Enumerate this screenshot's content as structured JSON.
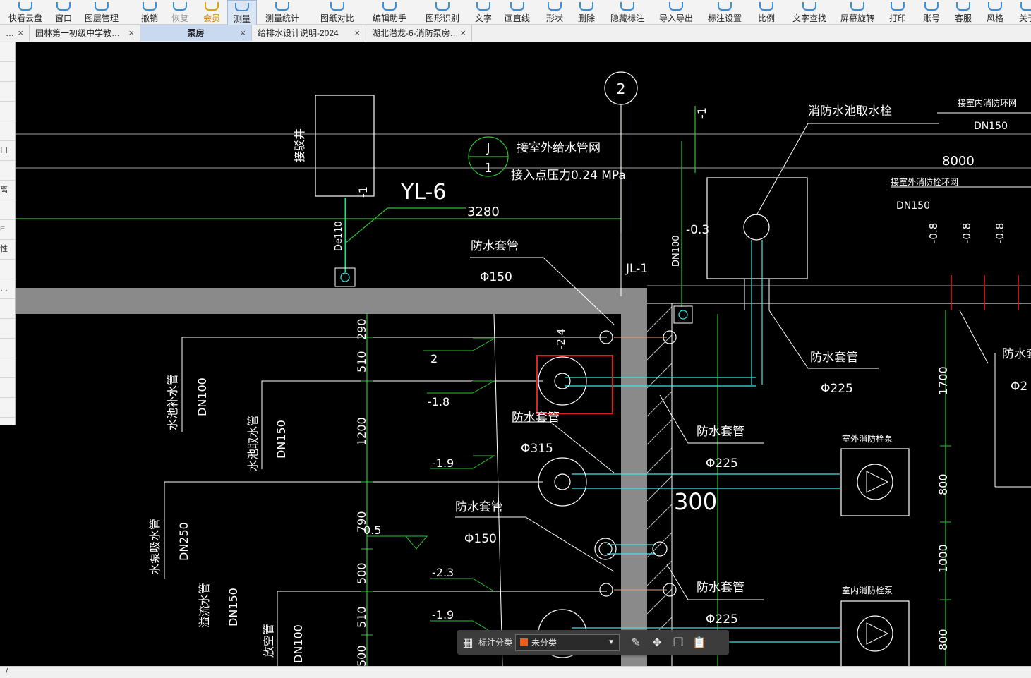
{
  "toolbar": {
    "items": [
      {
        "label": "快看云盘",
        "icon": "cloud-icon"
      },
      {
        "label": "窗口",
        "icon": "window-icon"
      },
      {
        "label": "图层管理",
        "icon": "layers-icon"
      },
      {
        "label": "撤销",
        "icon": "undo-icon"
      },
      {
        "label": "恢复",
        "icon": "redo-icon"
      },
      {
        "label": "会员",
        "icon": "crown-icon"
      },
      {
        "label": "测量",
        "icon": "ruler-icon"
      },
      {
        "label": "测量统计",
        "icon": "stats-icon"
      },
      {
        "label": "图纸对比",
        "icon": "compare-icon"
      },
      {
        "label": "编辑助手",
        "icon": "edit-icon"
      },
      {
        "label": "图形识别",
        "icon": "recognize-icon"
      },
      {
        "label": "文字",
        "icon": "text-icon"
      },
      {
        "label": "画直线",
        "icon": "line-icon"
      },
      {
        "label": "形状",
        "icon": "shape-icon"
      },
      {
        "label": "删除",
        "icon": "delete-icon"
      },
      {
        "label": "隐藏标注",
        "icon": "hide-icon"
      },
      {
        "label": "导入导出",
        "icon": "import-export-icon"
      },
      {
        "label": "标注设置",
        "icon": "settings-icon"
      },
      {
        "label": "比例",
        "icon": "scale-icon"
      },
      {
        "label": "文字查找",
        "icon": "search-icon"
      },
      {
        "label": "屏幕旋转",
        "icon": "rotate-icon"
      },
      {
        "label": "打印",
        "icon": "print-icon"
      },
      {
        "label": "账号",
        "icon": "account-icon"
      },
      {
        "label": "客服",
        "icon": "service-icon"
      },
      {
        "label": "风格",
        "icon": "style-icon"
      },
      {
        "label": "关于",
        "icon": "about-icon"
      }
    ]
  },
  "tabs": [
    {
      "label": "…"
    },
    {
      "label": "园林第一初级中学教…"
    },
    {
      "label": "泵房"
    },
    {
      "label": "给排水设计说明-2024"
    },
    {
      "label": "湖北潜龙-6-消防泵房…"
    }
  ],
  "close_glyph": "×",
  "left_panel": {
    "rows": [
      "",
      "",
      "",
      "",
      "",
      "口",
      "",
      "离",
      "",
      "E",
      "性",
      "",
      "…",
      "",
      "",
      "",
      "",
      "",
      ""
    ]
  },
  "drawing": {
    "grid_axis": "2",
    "ref_mark_top": "J",
    "ref_mark_bottom": "1",
    "labels": [
      "接室外给水管网",
      "接入点压力0.24 MPa",
      "YL-6",
      "3280",
      "接驳井",
      "De110",
      "-1",
      "-1",
      "防水套管",
      "Φ150",
      "JL-1",
      "-0.3",
      "DN100",
      "消防水池取水栓",
      "接室内消防环网",
      "DN150",
      "8000",
      "接室外消防栓环网",
      "DN150",
      "-0.8",
      "-0.8",
      "-0.8",
      "防水套管",
      "Φ225",
      "防水套管",
      "Φ2",
      "-2.4",
      "2",
      "-1.8",
      "防水套管",
      "Φ315",
      "防水套管",
      "Φ225",
      "室外消防栓泵",
      "-1.9",
      "300",
      "防水套管",
      "Φ150",
      "0.5",
      "-2.3",
      "防水套管",
      "-1.9",
      "Φ225",
      "室内消防栓泵",
      "水池补水管",
      "DN100",
      "水池取水管",
      "DN150",
      "水泵吸水管",
      "DN250",
      "溢流水管",
      "DN150",
      "放空管",
      "DN100",
      "290",
      "510",
      "1200",
      "790",
      "500",
      "510",
      "500",
      "1700",
      "800",
      "1000",
      "800"
    ]
  },
  "float_bar": {
    "label": "标注分类",
    "selected": "未分类",
    "swatch_color": "#e8601c"
  },
  "status": {
    "text": "/"
  },
  "colors": {
    "cad_white": "#ffffff",
    "cad_green": "#29c42e",
    "cad_cyan": "#3ee6e6",
    "cad_gray": "#8a8a8a",
    "highlight_red": "#e02020"
  }
}
